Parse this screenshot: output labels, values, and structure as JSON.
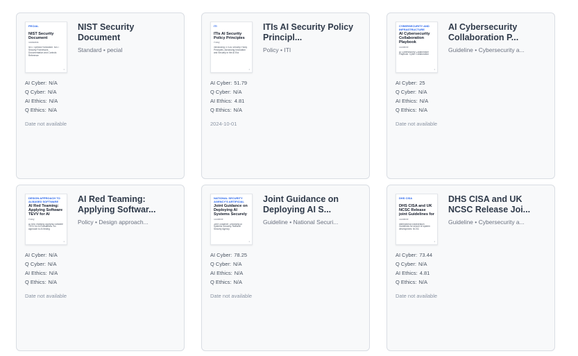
{
  "cards": [
    {
      "thumb": {
        "brand": "PECIAL",
        "title": "NIST Security Document",
        "subtitle": "Standards",
        "body": "NIST Special Publication. NIST Security Framework. Documentation and Controls Reference",
        "page": "1"
      },
      "title": "NIST Security Document",
      "category": "Standard • pecial",
      "scores": [
        {
          "label": "AI Cyber:",
          "value": "N/A"
        },
        {
          "label": "Q Cyber:",
          "value": "N/A"
        },
        {
          "label": "AI Ethics:",
          "value": "N/A"
        },
        {
          "label": "Q Ethics:",
          "value": "N/A"
        }
      ],
      "date": "Date not available"
    },
    {
      "thumb": {
        "brand": "ITI",
        "title": "ITIs AI Security Policy Principles",
        "subtitle": "Policy",
        "body": "Introducing ITI's AI Security Policy Principles. Advancing Innovation and Security in the AI Era",
        "page": "1"
      },
      "title": "ITIs AI Security Policy Principl...",
      "category": "Policy • ITI",
      "scores": [
        {
          "label": "AI Cyber:",
          "value": "51.79"
        },
        {
          "label": "Q Cyber:",
          "value": "N/A"
        },
        {
          "label": "AI Ethics:",
          "value": "4.81"
        },
        {
          "label": "Q Ethics:",
          "value": "N/A"
        }
      ],
      "date": "2024-10-01"
    },
    {
      "thumb": {
        "brand": "Cybersecurity and Infrastructure",
        "title": "AI Cybersecurity Collaboration Playbook",
        "subtitle": "Guideline",
        "body": "AI Cybersecurity Collaboration Playbook. Cyber Collaboration",
        "page": "1"
      },
      "title": "AI Cybersecurity Collaboration P...",
      "category": "Guideline • Cybersecurity a...",
      "scores": [
        {
          "label": "AI Cyber:",
          "value": "25"
        },
        {
          "label": "Q Cyber:",
          "value": "N/A"
        },
        {
          "label": "AI Ethics:",
          "value": "N/A"
        },
        {
          "label": "Q Ethics:",
          "value": "N/A"
        }
      ],
      "date": "Date not available"
    },
    {
      "thumb": {
        "brand": "Design approach to AI-based software",
        "title": "AI Red Teaming: Applying Software TEVV for AI",
        "subtitle": "Policy",
        "body": "AI Red Teaming: Applying Software TEVV for AI Evaluations. An approach to AI testing",
        "page": "1"
      },
      "title": "AI Red Teaming: Applying Softwar...",
      "category": "Policy • Design approach...",
      "scores": [
        {
          "label": "AI Cyber:",
          "value": "N/A"
        },
        {
          "label": "Q Cyber:",
          "value": "N/A"
        },
        {
          "label": "AI Ethics:",
          "value": "N/A"
        },
        {
          "label": "Q Ethics:",
          "value": "N/A"
        }
      ],
      "date": "Date not available"
    },
    {
      "thumb": {
        "brand": "National Security Agency's Artificial",
        "title": "Joint Guidance on Deploying AI Systems Securely",
        "subtitle": "Guideline",
        "body": "Joint Guidance. Deploying AI Systems Securely. National Security Agency",
        "page": "1"
      },
      "title": "Joint Guidance on Deploying AI S...",
      "category": "Guideline • National Securi...",
      "scores": [
        {
          "label": "AI Cyber:",
          "value": "78.25"
        },
        {
          "label": "Q Cyber:",
          "value": "N/A"
        },
        {
          "label": "AI Ethics:",
          "value": "N/A"
        },
        {
          "label": "Q Ethics:",
          "value": "N/A"
        }
      ],
      "date": "Date not available"
    },
    {
      "thumb": {
        "brand": "DHS CISA",
        "title": "DHS CISA and UK NCSC Release joint Guidelines for",
        "subtitle": "Guideline",
        "body": "International collaboration. Guidelines for secure AI system development. NCSC",
        "page": "1"
      },
      "title": "DHS CISA and UK NCSC Release Joi...",
      "category": "Guideline • Cybersecurity a...",
      "scores": [
        {
          "label": "AI Cyber:",
          "value": "73.44"
        },
        {
          "label": "Q Cyber:",
          "value": "N/A"
        },
        {
          "label": "AI Ethics:",
          "value": "4.81"
        },
        {
          "label": "Q Ethics:",
          "value": "N/A"
        }
      ],
      "date": "Date not available"
    }
  ]
}
